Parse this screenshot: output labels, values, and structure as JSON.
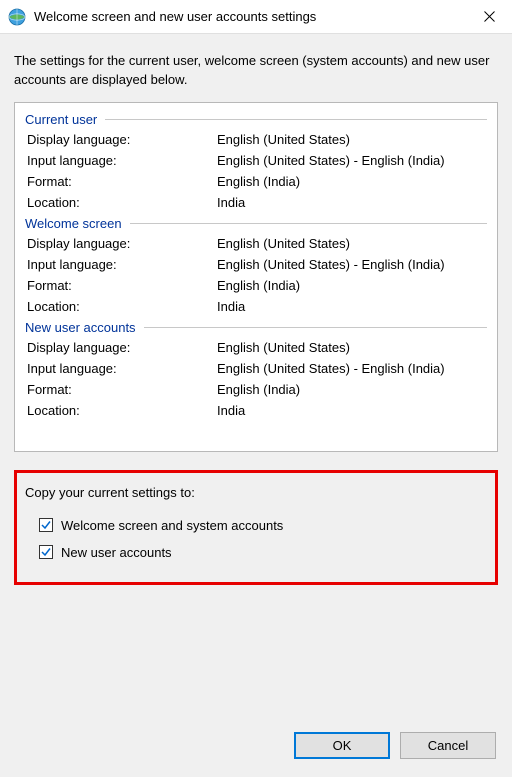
{
  "title": "Welcome screen and new user accounts settings",
  "description": "The settings for the current user, welcome screen (system accounts) and new user accounts are displayed below.",
  "sections": [
    {
      "heading": "Current user",
      "rows": [
        {
          "label": "Display language:",
          "value": "English (United States)"
        },
        {
          "label": "Input language:",
          "value": "English (United States) - English (India)"
        },
        {
          "label": "Format:",
          "value": "English (India)"
        },
        {
          "label": "Location:",
          "value": "India"
        }
      ]
    },
    {
      "heading": "Welcome screen",
      "rows": [
        {
          "label": "Display language:",
          "value": "English (United States)"
        },
        {
          "label": "Input language:",
          "value": "English (United States) - English (India)"
        },
        {
          "label": "Format:",
          "value": "English (India)"
        },
        {
          "label": "Location:",
          "value": "India"
        }
      ]
    },
    {
      "heading": "New user accounts",
      "rows": [
        {
          "label": "Display language:",
          "value": "English (United States)"
        },
        {
          "label": "Input language:",
          "value": "English (United States) - English (India)"
        },
        {
          "label": "Format:",
          "value": "English (India)"
        },
        {
          "label": "Location:",
          "value": "India"
        }
      ]
    }
  ],
  "copy": {
    "title": "Copy your current settings to:",
    "opt1": "Welcome screen and system accounts",
    "opt2": "New user accounts"
  },
  "buttons": {
    "ok": "OK",
    "cancel": "Cancel"
  }
}
